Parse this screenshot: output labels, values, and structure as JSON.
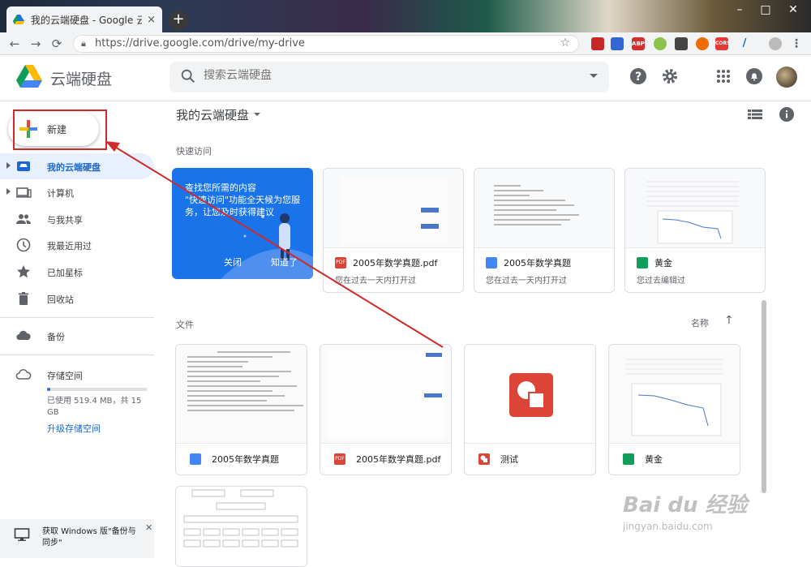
{
  "browser": {
    "tab_title": "我的云端硬盘 - Google 云端硬盘",
    "tab_close": "×",
    "new_tab": "+",
    "url": "https://drive.google.com/drive/my-drive",
    "window_controls": [
      "–",
      "□",
      "✕"
    ],
    "extensions": [
      "ABP",
      "CORS"
    ]
  },
  "header": {
    "product_name": "云端硬盘",
    "search_placeholder": "搜索云端硬盘"
  },
  "sidebar": {
    "new_label": "新建",
    "items": [
      {
        "label": "我的云端硬盘",
        "icon": "drive-icon"
      },
      {
        "label": "计算机",
        "icon": "computer-icon"
      },
      {
        "label": "与我共享",
        "icon": "shared-icon"
      },
      {
        "label": "我最近用过",
        "icon": "clock-icon"
      },
      {
        "label": "已加星标",
        "icon": "star-icon"
      },
      {
        "label": "回收站",
        "icon": "trash-icon"
      },
      {
        "label": "备份",
        "icon": "cloud-icon"
      },
      {
        "label": "存储空间",
        "icon": "cloud-outline-icon"
      }
    ],
    "storage_used": "已使用 519.4 MB，共 15 GB",
    "storage_fraction": 0.034,
    "upgrade_label": "升级存储空间",
    "backup_banner": "获取 Windows 版\"备份与同步\""
  },
  "main": {
    "title": "我的云端硬盘",
    "quick_access_label": "快速访问",
    "promo": {
      "text": "查找您所需的内容\n\"快速访问\"功能全天候为您服务，让您及时获得建议",
      "close": "关闭",
      "got_it": "知道了"
    },
    "quick_access": [
      {
        "name": "2005年数学真题.pdf",
        "sub": "您在过去一天内打开过",
        "type": "pdf"
      },
      {
        "name": "2005年数学真题",
        "sub": "您在过去一天内打开过",
        "type": "doc"
      },
      {
        "name": "黄金",
        "sub": "您过去编辑过",
        "type": "sheet"
      }
    ],
    "files_label": "文件",
    "sort_label": "名称",
    "sort_dir": "↑",
    "files": [
      {
        "name": "2005年数学真题",
        "type": "doc"
      },
      {
        "name": "2005年数学真题.pdf",
        "type": "pdf"
      },
      {
        "name": "测试",
        "type": "drawing"
      },
      {
        "name": "黄金",
        "type": "sheet"
      }
    ]
  },
  "watermark": {
    "line1": "Bai du 经验",
    "line2": "jingyan.baidu.com"
  },
  "colors": {
    "accent": "#1a73e8",
    "pdf": "#db4437",
    "doc": "#4285f4",
    "sheet": "#0f9d58",
    "annotation": "#d02a2a"
  }
}
